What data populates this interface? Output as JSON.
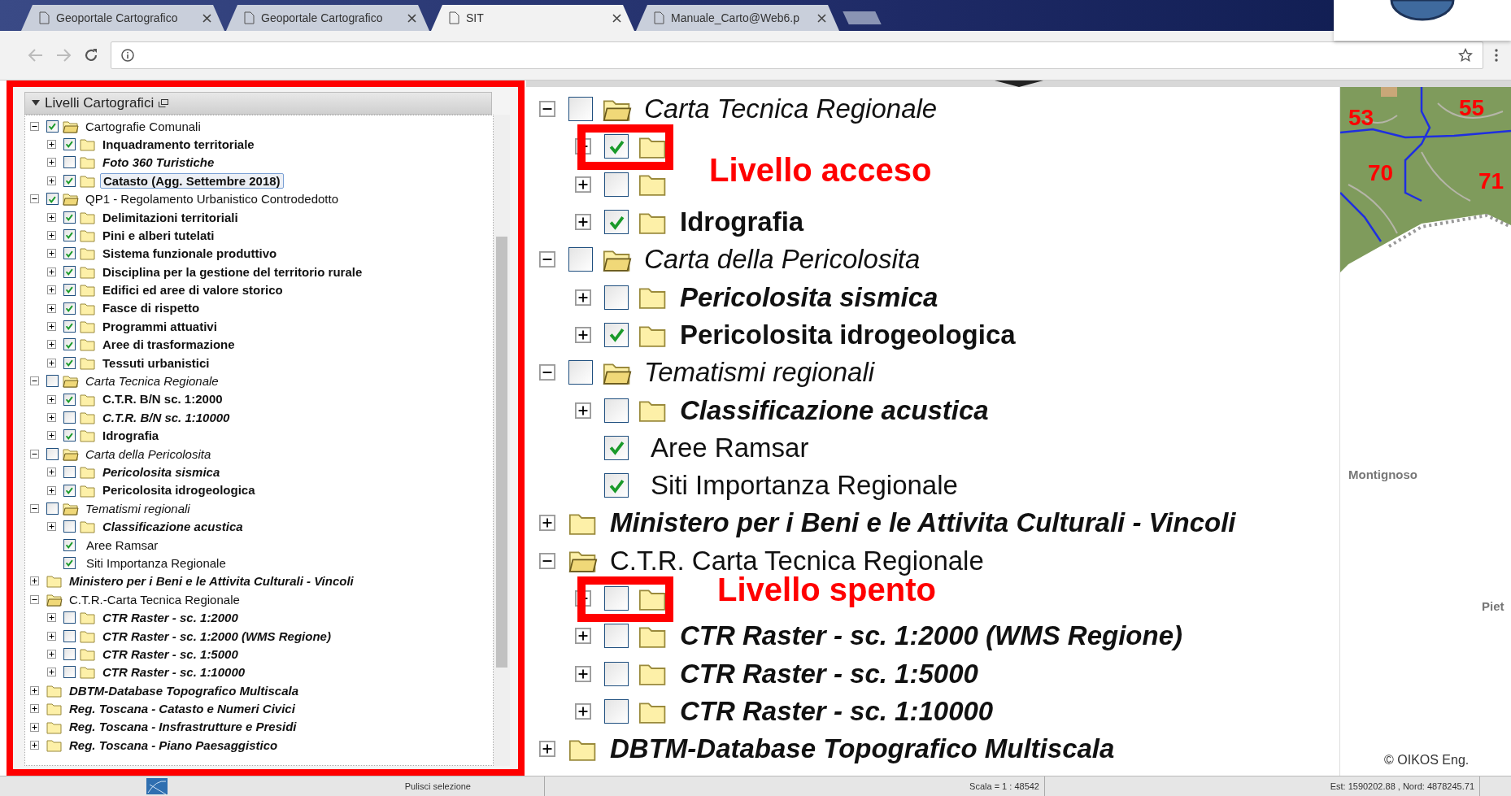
{
  "browser": {
    "tabs": [
      {
        "title": "Geoportale Cartografico",
        "selected": false
      },
      {
        "title": "Geoportale Cartografico",
        "selected": false
      },
      {
        "title": "SIT",
        "selected": true
      },
      {
        "title": "Manuale_Carto@Web6.p",
        "selected": false
      }
    ]
  },
  "layers_panel": {
    "title": "Livelli Cartografici",
    "tree": [
      {
        "label": "Cartografie Comunali",
        "kind": "folder",
        "expanded": true,
        "checked": true,
        "italic": false,
        "bold": false,
        "selected": false,
        "children": [
          {
            "label": "Inquadramento territoriale",
            "kind": "folder",
            "expanded": false,
            "checked": true,
            "italic": false,
            "bold": true,
            "selected": false
          },
          {
            "label": "Foto 360 Turistiche",
            "kind": "folder",
            "expanded": false,
            "checked": false,
            "italic": true,
            "bold": true,
            "selected": false
          },
          {
            "label": "Catasto (Agg. Settembre 2018)",
            "kind": "folder",
            "expanded": false,
            "checked": true,
            "italic": false,
            "bold": true,
            "selected": true
          }
        ]
      },
      {
        "label": "QP1 - Regolamento Urbanistico Controdedotto",
        "kind": "folder",
        "expanded": true,
        "checked": true,
        "italic": false,
        "bold": false,
        "selected": false,
        "children": [
          {
            "label": "Delimitazioni territoriali",
            "kind": "folder",
            "expanded": false,
            "checked": true,
            "italic": false,
            "bold": true,
            "selected": false
          },
          {
            "label": "Pini e alberi tutelati",
            "kind": "folder",
            "expanded": false,
            "checked": true,
            "italic": false,
            "bold": true,
            "selected": false
          },
          {
            "label": "Sistema funzionale produttivo",
            "kind": "folder",
            "expanded": false,
            "checked": true,
            "italic": false,
            "bold": true,
            "selected": false
          },
          {
            "label": "Disciplina per la gestione del territorio rurale",
            "kind": "folder",
            "expanded": false,
            "checked": true,
            "italic": false,
            "bold": true,
            "selected": false
          },
          {
            "label": "Edifici ed aree di valore storico",
            "kind": "folder",
            "expanded": false,
            "checked": true,
            "italic": false,
            "bold": true,
            "selected": false
          },
          {
            "label": "Fasce di rispetto",
            "kind": "folder",
            "expanded": false,
            "checked": true,
            "italic": false,
            "bold": true,
            "selected": false
          },
          {
            "label": "Programmi attuativi",
            "kind": "folder",
            "expanded": false,
            "checked": true,
            "italic": false,
            "bold": true,
            "selected": false
          },
          {
            "label": "Aree di trasformazione",
            "kind": "folder",
            "expanded": false,
            "checked": true,
            "italic": false,
            "bold": true,
            "selected": false
          },
          {
            "label": "Tessuti urbanistici",
            "kind": "folder",
            "expanded": false,
            "checked": true,
            "italic": false,
            "bold": true,
            "selected": false
          }
        ]
      },
      {
        "label": "Carta Tecnica Regionale",
        "kind": "folder",
        "expanded": true,
        "checked": false,
        "italic": true,
        "bold": false,
        "selected": false,
        "children": [
          {
            "label": "C.T.R. B/N sc. 1:2000",
            "kind": "folder",
            "expanded": false,
            "checked": true,
            "italic": false,
            "bold": true,
            "selected": false
          },
          {
            "label": "C.T.R. B/N sc. 1:10000",
            "kind": "folder",
            "expanded": false,
            "checked": false,
            "italic": true,
            "bold": true,
            "selected": false
          },
          {
            "label": "Idrografia",
            "kind": "folder",
            "expanded": false,
            "checked": true,
            "italic": false,
            "bold": true,
            "selected": false
          }
        ]
      },
      {
        "label": "Carta della Pericolosita",
        "kind": "folder",
        "expanded": true,
        "checked": false,
        "italic": true,
        "bold": false,
        "selected": false,
        "children": [
          {
            "label": "Pericolosita sismica",
            "kind": "folder",
            "expanded": false,
            "checked": false,
            "italic": true,
            "bold": true,
            "selected": false
          },
          {
            "label": "Pericolosita idrogeologica",
            "kind": "folder",
            "expanded": false,
            "checked": true,
            "italic": false,
            "bold": true,
            "selected": false
          }
        ]
      },
      {
        "label": "Tematismi regionali",
        "kind": "folder",
        "expanded": true,
        "checked": false,
        "italic": true,
        "bold": false,
        "selected": false,
        "children": [
          {
            "label": "Classificazione acustica",
            "kind": "folder",
            "expanded": false,
            "checked": false,
            "italic": true,
            "bold": true,
            "selected": false
          },
          {
            "label": "Aree Ramsar",
            "kind": "leaf",
            "checked": true,
            "italic": false,
            "bold": false,
            "selected": false
          },
          {
            "label": "Siti Importanza Regionale",
            "kind": "leaf",
            "checked": true,
            "italic": false,
            "bold": false,
            "selected": false
          }
        ]
      },
      {
        "label": "Ministero per i Beni e le Attivita Culturali - Vincoli",
        "kind": "folder",
        "expanded": false,
        "italic": true,
        "bold": true,
        "selected": false
      },
      {
        "label": "C.T.R.-Carta Tecnica Regionale",
        "kind": "folder",
        "expanded": true,
        "italic": false,
        "bold": false,
        "selected": false,
        "children": [
          {
            "label": "CTR Raster - sc. 1:2000",
            "kind": "folder",
            "expanded": false,
            "checked": false,
            "italic": true,
            "bold": true,
            "selected": false
          },
          {
            "label": "CTR Raster - sc. 1:2000 (WMS Regione)",
            "kind": "folder",
            "expanded": false,
            "checked": false,
            "italic": true,
            "bold": true,
            "selected": false
          },
          {
            "label": "CTR Raster - sc. 1:5000",
            "kind": "folder",
            "expanded": false,
            "checked": false,
            "italic": true,
            "bold": true,
            "selected": false
          },
          {
            "label": "CTR Raster - sc. 1:10000",
            "kind": "folder",
            "expanded": false,
            "checked": false,
            "italic": true,
            "bold": true,
            "selected": false
          }
        ]
      },
      {
        "label": "DBTM-Database Topografico Multiscala",
        "kind": "folder",
        "expanded": false,
        "italic": true,
        "bold": true,
        "selected": false
      },
      {
        "label": "Reg. Toscana - Catasto e Numeri Civici",
        "kind": "folder",
        "expanded": false,
        "italic": true,
        "bold": true,
        "selected": false
      },
      {
        "label": "Reg. Toscana - Insfrastrutture e Presidi",
        "kind": "folder",
        "expanded": false,
        "italic": true,
        "bold": true,
        "selected": false
      },
      {
        "label": "Reg. Toscana - Piano Paesaggistico",
        "kind": "folder",
        "expanded": false,
        "italic": true,
        "bold": true,
        "selected": false
      }
    ]
  },
  "magnified_tree": [
    {
      "label": "Carta Tecnica Regionale",
      "kind": "folder",
      "expanded": true,
      "checked": false,
      "italic": true,
      "bold": false,
      "children": [
        {
          "kind": "folder",
          "expanded": false,
          "checked": true
        },
        {
          "kind": "folder",
          "expanded": false,
          "checked": false
        },
        {
          "label": "Idrografia",
          "kind": "folder",
          "expanded": false,
          "checked": true,
          "italic": false,
          "bold": true
        }
      ]
    },
    {
      "label": "Carta della Pericolosita",
      "kind": "folder",
      "expanded": true,
      "checked": false,
      "italic": true,
      "bold": false,
      "children": [
        {
          "label": "Pericolosita sismica",
          "kind": "folder",
          "expanded": false,
          "checked": false,
          "italic": true,
          "bold": true
        },
        {
          "label": "Pericolosita idrogeologica",
          "kind": "folder",
          "expanded": false,
          "checked": true,
          "italic": false,
          "bold": true
        }
      ]
    },
    {
      "label": "Tematismi regionali",
      "kind": "folder",
      "expanded": true,
      "checked": false,
      "italic": true,
      "bold": false,
      "children": [
        {
          "label": "Classificazione acustica",
          "kind": "folder",
          "expanded": false,
          "checked": false,
          "italic": true,
          "bold": true
        },
        {
          "label": "Aree Ramsar",
          "kind": "leaf",
          "checked": true,
          "italic": false,
          "bold": false
        },
        {
          "label": "Siti Importanza Regionale",
          "kind": "leaf",
          "checked": true,
          "italic": false,
          "bold": false
        }
      ]
    },
    {
      "label": "Ministero per i Beni e le Attivita Culturali - Vincoli",
      "kind": "folder",
      "expanded": false,
      "italic": true,
      "bold": true
    },
    {
      "label": "C.T.R. Carta Tecnica Regionale",
      "kind": "folder",
      "expanded": true,
      "italic": false,
      "bold": false,
      "children": [
        {
          "kind": "folder",
          "expanded": false,
          "checked": false
        },
        {
          "label": "CTR Raster - sc. 1:2000 (WMS Regione)",
          "kind": "folder",
          "expanded": false,
          "checked": false,
          "italic": true,
          "bold": true
        },
        {
          "label": "CTR Raster - sc. 1:5000",
          "kind": "folder",
          "expanded": false,
          "checked": false,
          "italic": true,
          "bold": true
        },
        {
          "label": "CTR Raster - sc. 1:10000",
          "kind": "folder",
          "expanded": false,
          "checked": false,
          "italic": true,
          "bold": true
        }
      ]
    },
    {
      "label": "DBTM-Database Topografico Multiscala",
      "kind": "folder",
      "expanded": false,
      "italic": true,
      "bold": true
    }
  ],
  "callouts": [
    {
      "text": "Livello acceso"
    },
    {
      "text": "Livello spento"
    }
  ],
  "map": {
    "zone_labels": [
      "53",
      "55",
      "70",
      "71"
    ],
    "places": [
      "Montignoso",
      "Piet"
    ],
    "attribution": "© OIKOS Eng."
  },
  "status_bar": {
    "action": "Pulisci selezione",
    "scale": "Scala = 1 : 48542",
    "coordinates": "Est: 1590202.88 , Nord: 4878245.71"
  }
}
